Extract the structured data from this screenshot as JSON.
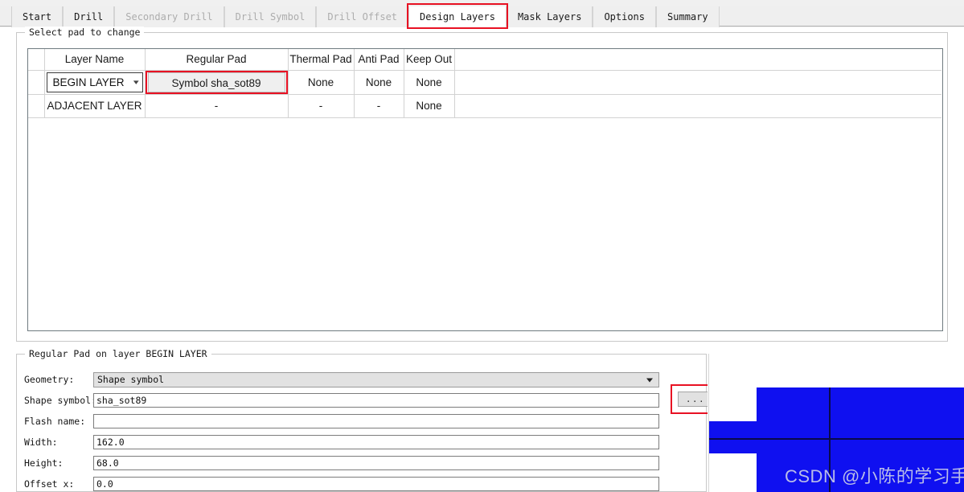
{
  "window": {
    "tabs": [
      {
        "label": "Start",
        "state": "normal"
      },
      {
        "label": "Drill",
        "state": "normal"
      },
      {
        "label": "Secondary Drill",
        "state": "disabled"
      },
      {
        "label": "Drill Symbol",
        "state": "disabled"
      },
      {
        "label": "Drill Offset",
        "state": "disabled"
      },
      {
        "label": "Design Layers",
        "state": "active"
      },
      {
        "label": "Mask Layers",
        "state": "normal"
      },
      {
        "label": "Options",
        "state": "normal"
      },
      {
        "label": "Summary",
        "state": "normal"
      }
    ]
  },
  "select_pad_group": {
    "title": "Select pad to change",
    "table": {
      "headers": [
        "",
        "Layer Name",
        "Regular Pad",
        "Thermal Pad",
        "Anti Pad",
        "Keep Out",
        ""
      ],
      "rows": [
        {
          "spacer": "",
          "layer_name": "BEGIN LAYER",
          "layer_name_is_select": true,
          "regular_pad": "Symbol sha_sot89",
          "regular_pad_highlighted": true,
          "thermal_pad": "None",
          "anti_pad": "None",
          "keep_out": "None",
          "rest": ""
        },
        {
          "spacer": "",
          "layer_name": "ADJACENT LAYER",
          "layer_name_is_select": false,
          "regular_pad": "-",
          "regular_pad_highlighted": false,
          "thermal_pad": "-",
          "anti_pad": "-",
          "keep_out": "None",
          "rest": ""
        }
      ]
    }
  },
  "regular_pad_group": {
    "title": "Regular Pad on layer BEGIN LAYER",
    "fields": {
      "geometry_label": "Geometry:",
      "geometry_value": "Shape symbol",
      "shape_symbol_label": "Shape symbol:",
      "shape_symbol_value": "sha_sot89",
      "shape_symbol_placeholder": "",
      "browse_button_label": "...",
      "flash_name_label": "Flash name:",
      "flash_name_value": "",
      "flash_name_placeholder": "",
      "width_label": "Width:",
      "width_value": "162.0",
      "height_label": "Height:",
      "height_value": "68.0",
      "offset_x_label": "Offset x:",
      "offset_x_value": "0.0"
    }
  },
  "preview": {
    "watermark": "CSDN @小陈的学习手册",
    "pad_color": "#0f10f0",
    "crosshair_color": "#0a0a4a"
  },
  "colors": {
    "highlight": "#e81123",
    "tab_bar_bg": "#efefef",
    "group_border": "#c8c8c8"
  }
}
